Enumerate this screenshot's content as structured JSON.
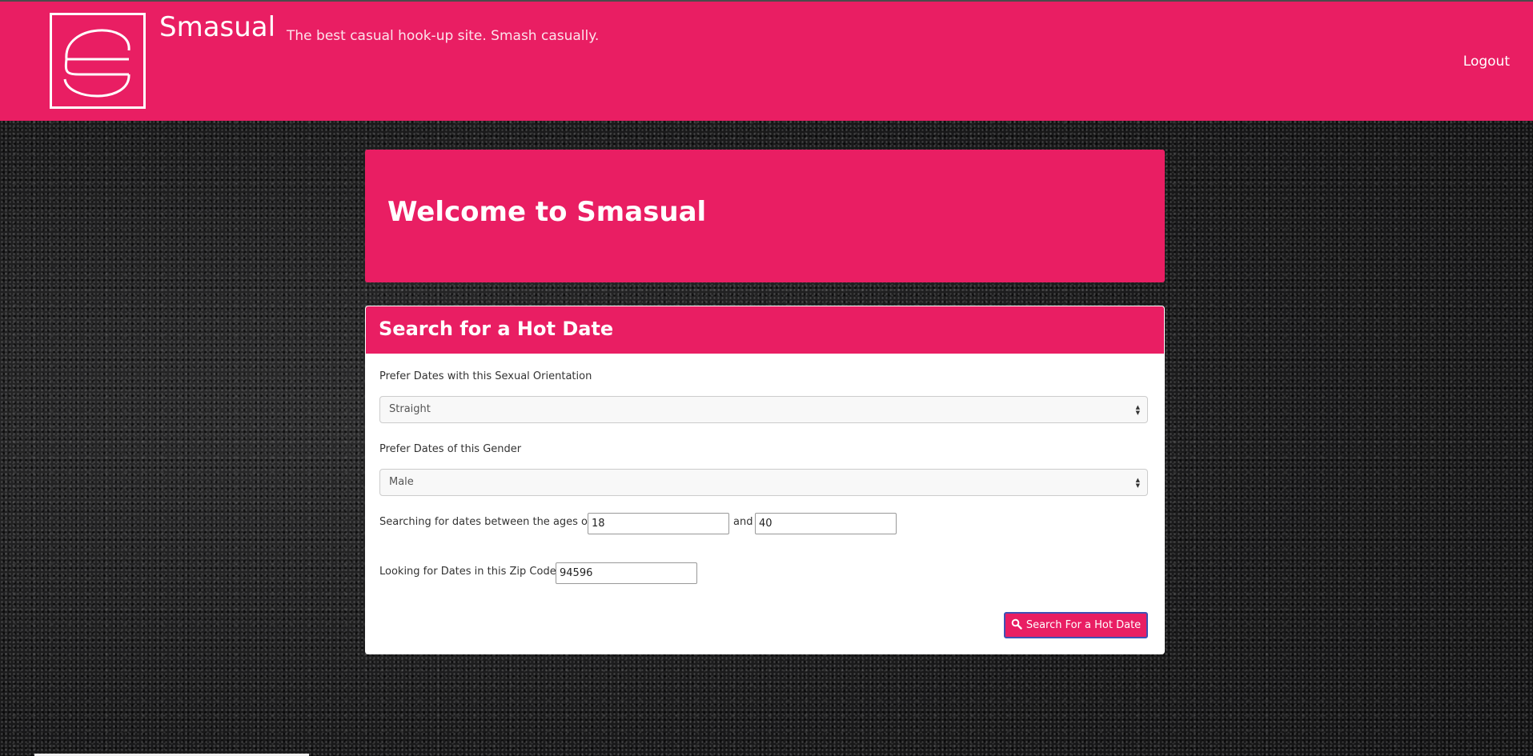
{
  "header": {
    "brand": "Smasual",
    "tagline": "The best casual hook-up site. Smash casually.",
    "logout_label": "Logout",
    "logo_icon": "smasual-s-logo-icon"
  },
  "welcome": {
    "title": "Welcome to Smasual"
  },
  "search_panel": {
    "title": "Search for a Hot Date",
    "orientation_label": "Prefer Dates with this Sexual Orientation",
    "orientation_value": "Straight",
    "gender_label": "Prefer Dates of this Gender",
    "gender_value": "Male",
    "ages_label": "Searching for dates between the ages of",
    "age_min": "18",
    "and_label": "and",
    "age_max": "40",
    "zip_label": "Looking for Dates in this Zip Code",
    "zip_value": "94596",
    "search_button_label": "Search For a Hot Date",
    "search_icon": "search-icon"
  },
  "colors": {
    "brand_pink": "#e91e63",
    "button_border": "#3f51b5",
    "background_dark": "#1c1c1d"
  }
}
